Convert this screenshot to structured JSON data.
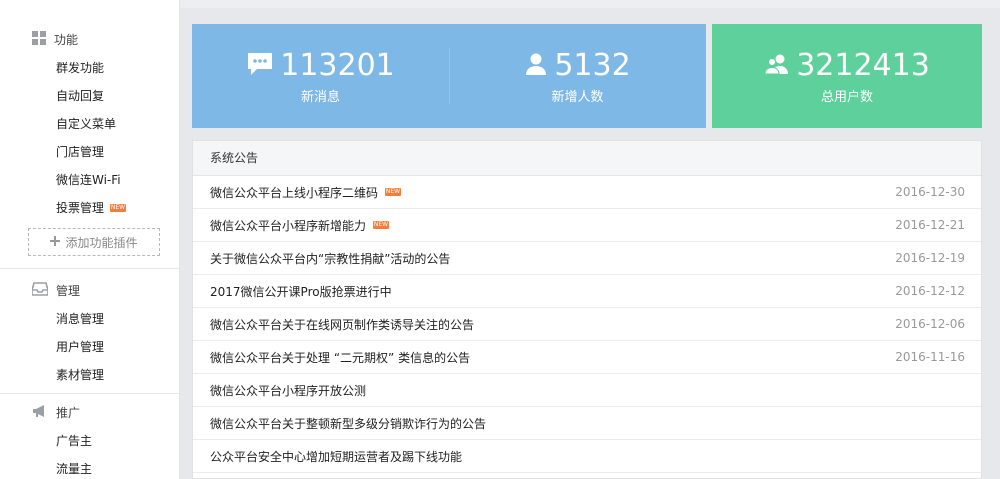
{
  "sidebar": {
    "groups": [
      {
        "title": "功能",
        "icon": "grid-icon",
        "items": [
          {
            "label": "群发功能"
          },
          {
            "label": "自动回复"
          },
          {
            "label": "自定义菜单"
          },
          {
            "label": "门店管理"
          },
          {
            "label": "微信连Wi-Fi"
          },
          {
            "label": "投票管理",
            "badge": "NEW"
          }
        ]
      },
      {
        "title": "管理",
        "icon": "inbox-icon",
        "items": [
          {
            "label": "消息管理"
          },
          {
            "label": "用户管理"
          },
          {
            "label": "素材管理"
          }
        ]
      },
      {
        "title": "推广",
        "icon": "megaphone-icon",
        "items": [
          {
            "label": "广告主"
          },
          {
            "label": "流量主"
          }
        ]
      }
    ],
    "add_plugin": "添加功能插件"
  },
  "stats": {
    "new_messages": {
      "value": "113201",
      "label": "新消息",
      "icon": "chat-icon"
    },
    "new_users": {
      "value": "5132",
      "label": "新增人数",
      "icon": "person-icon"
    },
    "total_users": {
      "value": "3212413",
      "label": "总用户数",
      "icon": "users-icon"
    }
  },
  "colors": {
    "blue_card": "#7db8e6",
    "green_card": "#5ed09b",
    "new_badge": "#f47c3c"
  },
  "notices": {
    "header": "系统公告",
    "rows": [
      {
        "title": "微信公众平台上线小程序二维码",
        "date": "2016-12-30",
        "badge": "NEW"
      },
      {
        "title": "微信公众平台小程序新增能力",
        "date": "2016-12-21",
        "badge": "NEW"
      },
      {
        "title": "关于微信公众平台内“宗教性捐献”活动的公告",
        "date": "2016-12-19"
      },
      {
        "title": "2017微信公开课Pro版抢票进行中",
        "date": "2016-12-12"
      },
      {
        "title": "微信公众平台关于在线网页制作类诱导关注的公告",
        "date": "2016-12-06"
      },
      {
        "title": "微信公众平台关于处理 “二元期权” 类信息的公告",
        "date": "2016-11-16"
      },
      {
        "title": "微信公众平台小程序开放公测",
        "date": ""
      },
      {
        "title": "微信公众平台关于整顿新型多级分销欺诈行为的公告",
        "date": ""
      },
      {
        "title": "公众平台安全中心增加短期运营者及踢下线功能",
        "date": ""
      }
    ]
  }
}
